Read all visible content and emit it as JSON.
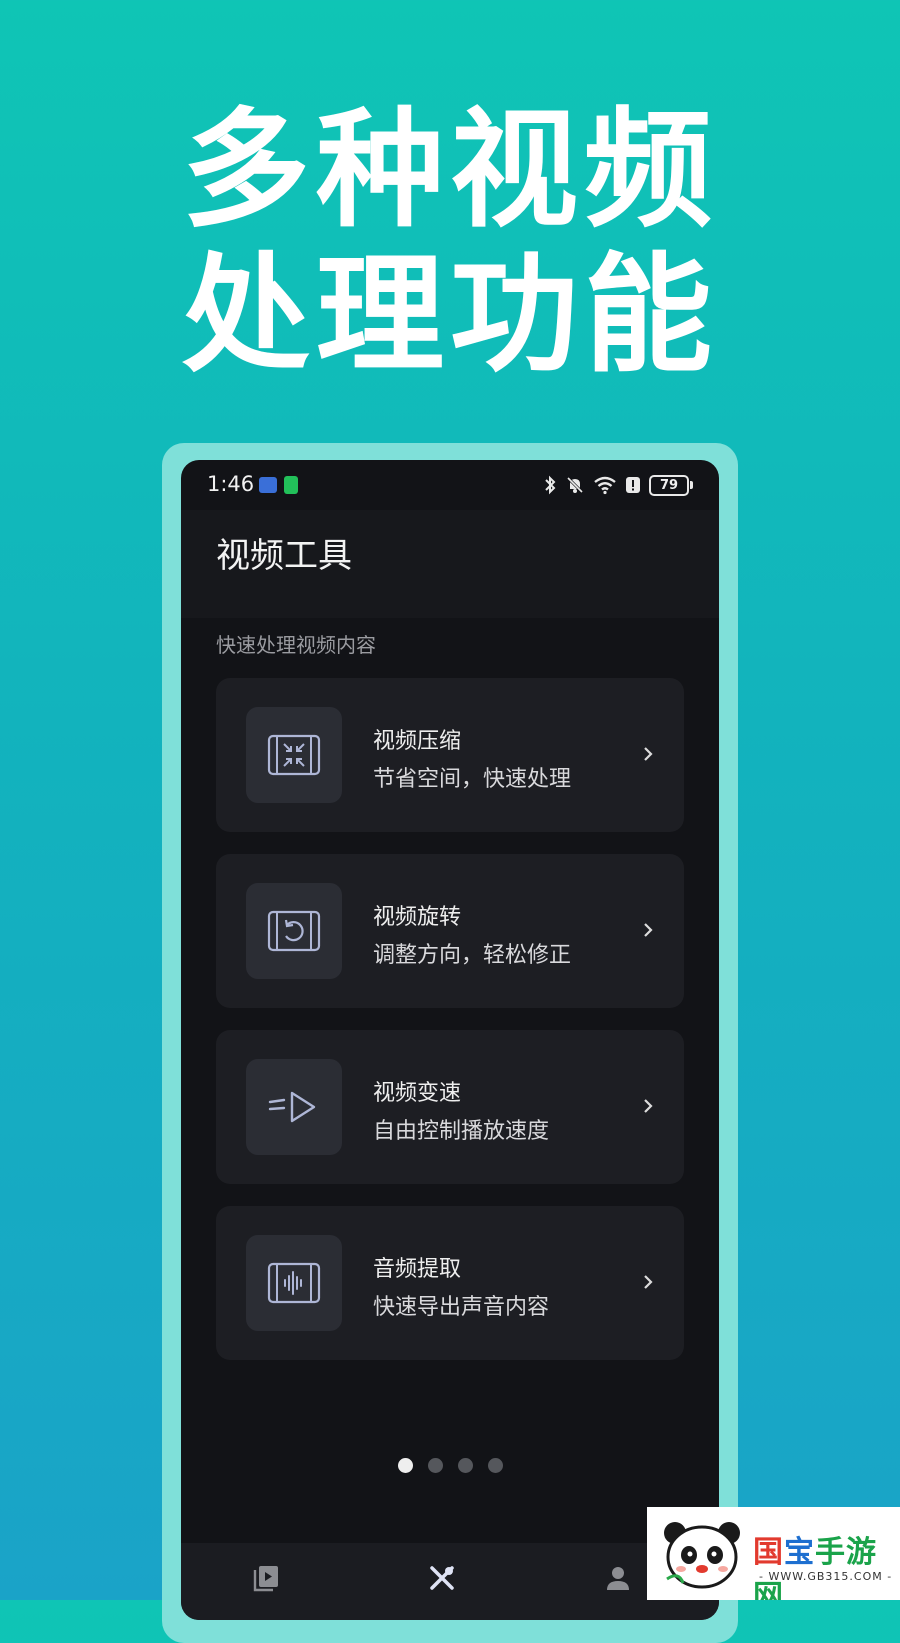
{
  "promo": {
    "line1": "多种视频",
    "line2": "处理功能"
  },
  "status_bar": {
    "time": "1:46",
    "battery_level": "79",
    "icons": [
      "usb-icon",
      "battery-saver-icon",
      "bluetooth-icon",
      "mute-icon",
      "wifi-icon",
      "alert-icon",
      "battery-icon"
    ]
  },
  "header": {
    "title": "视频工具"
  },
  "section": {
    "subtitle": "快速处理视频内容"
  },
  "tools": [
    {
      "name": "视频压缩",
      "desc": "节省空间，快速处理",
      "icon": "compress-icon"
    },
    {
      "name": "视频旋转",
      "desc": "调整方向，轻松修正",
      "icon": "rotate-icon"
    },
    {
      "name": "视频变速",
      "desc": "自由控制播放速度",
      "icon": "speed-icon"
    },
    {
      "name": "音频提取",
      "desc": "快速导出声音内容",
      "icon": "audio-extract-icon"
    }
  ],
  "pager": {
    "count": 4,
    "active": 0
  },
  "bottom_nav": {
    "items": [
      "video-library-icon",
      "tools-icon",
      "profile-icon"
    ],
    "active": 1
  },
  "watermark": {
    "title_part1": "国",
    "title_part2": "宝",
    "title_part3": "手游网",
    "url": "- WWW.GB315.COM -"
  },
  "colors": {
    "background_top": "#0fc5b5",
    "background_bottom": "#1aa3c8",
    "phone_frame": "#7fe0d9",
    "screen_bg": "#121317",
    "card_bg": "#1d1e23",
    "icon_stroke": "#aeb6d6"
  }
}
